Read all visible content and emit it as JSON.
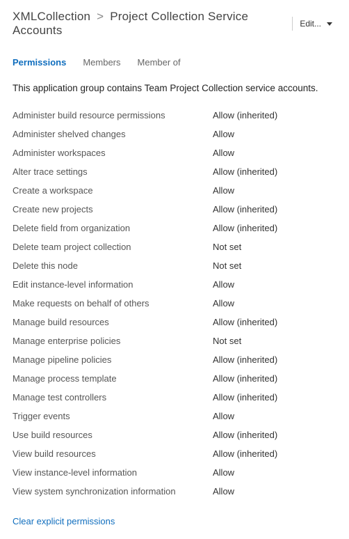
{
  "breadcrumb": {
    "root": "XMLCollection",
    "current": "Project Collection Service Accounts"
  },
  "edit_button": {
    "label": "Edit..."
  },
  "tabs": [
    {
      "id": "permissions",
      "label": "Permissions",
      "active": true
    },
    {
      "id": "members",
      "label": "Members",
      "active": false
    },
    {
      "id": "memberof",
      "label": "Member of",
      "active": false
    }
  ],
  "description": "This application group contains Team Project Collection service accounts.",
  "permissions": [
    {
      "name": "Administer build resource permissions",
      "value": "Allow (inherited)"
    },
    {
      "name": "Administer shelved changes",
      "value": "Allow"
    },
    {
      "name": "Administer workspaces",
      "value": "Allow"
    },
    {
      "name": "Alter trace settings",
      "value": "Allow (inherited)"
    },
    {
      "name": "Create a workspace",
      "value": "Allow"
    },
    {
      "name": "Create new projects",
      "value": "Allow (inherited)"
    },
    {
      "name": "Delete field from organization",
      "value": "Allow (inherited)"
    },
    {
      "name": "Delete team project collection",
      "value": "Not set"
    },
    {
      "name": "Delete this node",
      "value": "Not set"
    },
    {
      "name": "Edit instance-level information",
      "value": "Allow"
    },
    {
      "name": "Make requests on behalf of others",
      "value": "Allow"
    },
    {
      "name": "Manage build resources",
      "value": "Allow (inherited)"
    },
    {
      "name": "Manage enterprise policies",
      "value": "Not set"
    },
    {
      "name": "Manage pipeline policies",
      "value": "Allow (inherited)"
    },
    {
      "name": "Manage process template",
      "value": "Allow (inherited)"
    },
    {
      "name": "Manage test controllers",
      "value": "Allow (inherited)"
    },
    {
      "name": "Trigger events",
      "value": "Allow"
    },
    {
      "name": "Use build resources",
      "value": "Allow (inherited)"
    },
    {
      "name": "View build resources",
      "value": "Allow (inherited)"
    },
    {
      "name": "View instance-level information",
      "value": "Allow"
    },
    {
      "name": "View system synchronization information",
      "value": "Allow"
    }
  ],
  "clear_link": "Clear explicit permissions"
}
